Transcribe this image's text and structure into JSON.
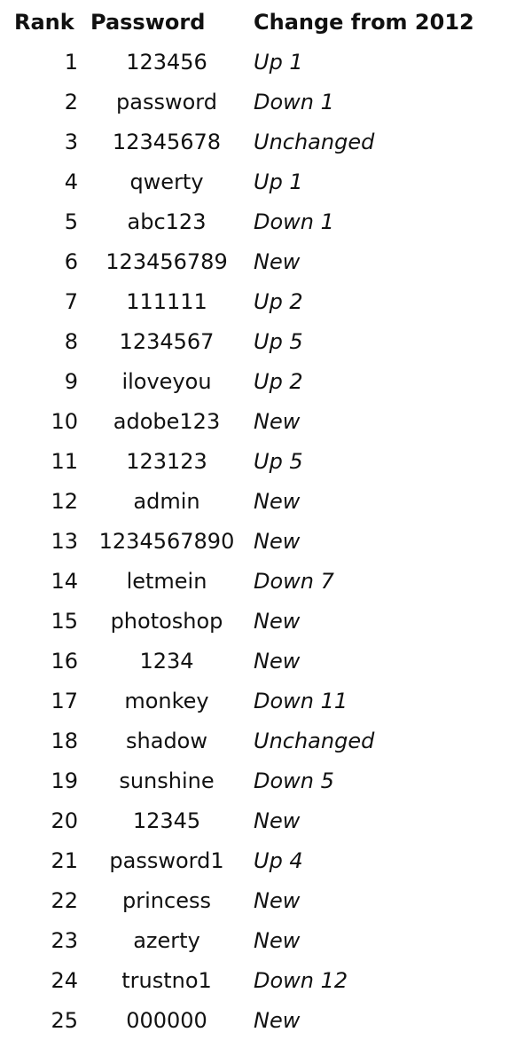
{
  "headers": {
    "rank": "Rank",
    "password": "Password",
    "change": "Change from 2012"
  },
  "rows": [
    {
      "rank": "1",
      "password": "123456",
      "change": "Up 1"
    },
    {
      "rank": "2",
      "password": "password",
      "change": "Down 1"
    },
    {
      "rank": "3",
      "password": "12345678",
      "change": "Unchanged"
    },
    {
      "rank": "4",
      "password": "qwerty",
      "change": "Up 1"
    },
    {
      "rank": "5",
      "password": "abc123",
      "change": "Down 1"
    },
    {
      "rank": "6",
      "password": "123456789",
      "change": "New"
    },
    {
      "rank": "7",
      "password": "111111",
      "change": "Up 2"
    },
    {
      "rank": "8",
      "password": "1234567",
      "change": "Up 5"
    },
    {
      "rank": "9",
      "password": "iloveyou",
      "change": "Up 2"
    },
    {
      "rank": "10",
      "password": "adobe123",
      "change": "New"
    },
    {
      "rank": "11",
      "password": "123123",
      "change": "Up 5"
    },
    {
      "rank": "12",
      "password": "admin",
      "change": "New"
    },
    {
      "rank": "13",
      "password": "1234567890",
      "change": "New"
    },
    {
      "rank": "14",
      "password": "letmein",
      "change": "Down 7"
    },
    {
      "rank": "15",
      "password": "photoshop",
      "change": "New"
    },
    {
      "rank": "16",
      "password": "1234",
      "change": "New"
    },
    {
      "rank": "17",
      "password": "monkey",
      "change": "Down 11"
    },
    {
      "rank": "18",
      "password": "shadow",
      "change": "Unchanged"
    },
    {
      "rank": "19",
      "password": "sunshine",
      "change": "Down 5"
    },
    {
      "rank": "20",
      "password": "12345",
      "change": "New"
    },
    {
      "rank": "21",
      "password": "password1",
      "change": "Up 4"
    },
    {
      "rank": "22",
      "password": "princess",
      "change": "New"
    },
    {
      "rank": "23",
      "password": "azerty",
      "change": "New"
    },
    {
      "rank": "24",
      "password": "trustno1",
      "change": "Down 12"
    },
    {
      "rank": "25",
      "password": "000000",
      "change": "New"
    }
  ]
}
